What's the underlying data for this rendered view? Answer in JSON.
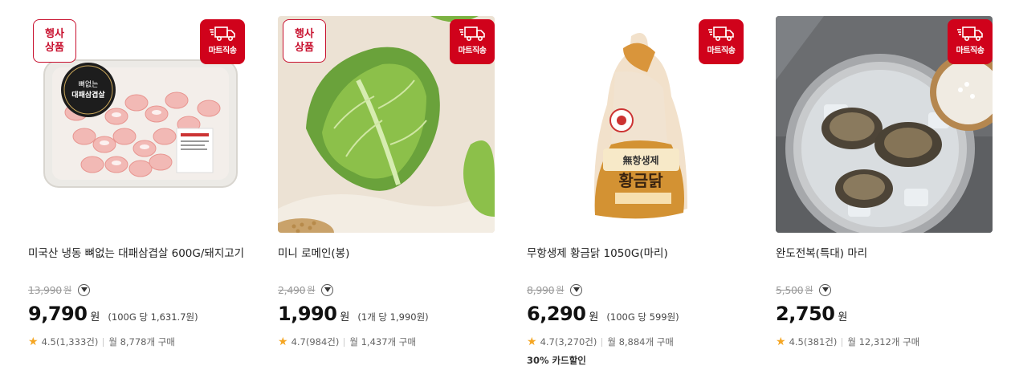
{
  "products": [
    {
      "name": "미국산 냉동 뼈없는 대패삼겹살 600G/돼지고기",
      "original_price": "13,990",
      "original_unit": "원",
      "price": "9,790",
      "price_unit": "원",
      "unit_price": "(100G 당 1,631.7원)",
      "rating": "4.5(1,333건)",
      "monthly": "월 8,778개 구매",
      "event_badge": [
        "행사",
        "상품"
      ],
      "ship_badge": "마트직송",
      "package_label": [
        "뼈없는",
        "대패삼겹살"
      ]
    },
    {
      "name": "미니 로메인(봉)",
      "original_price": "2,490",
      "original_unit": "원",
      "price": "1,990",
      "price_unit": "원",
      "unit_price": "(1개 당 1,990원)",
      "rating": "4.7(984건)",
      "monthly": "월 1,437개 구매",
      "event_badge": [
        "행사",
        "상품"
      ],
      "ship_badge": "마트직송"
    },
    {
      "name": "무항생제 황금닭 1050G(마리)",
      "original_price": "8,990",
      "original_unit": "원",
      "price": "6,290",
      "price_unit": "원",
      "unit_price": "(100G 당 599원)",
      "rating": "4.7(3,270건)",
      "monthly": "월 8,884개 구매",
      "card_discount": "30% 카드할인",
      "ship_badge": "마트직송",
      "package_label": [
        "無항생제",
        "황금닭"
      ]
    },
    {
      "name": "완도전복(특대) 마리",
      "original_price": "5,500",
      "original_unit": "원",
      "price": "2,750",
      "price_unit": "원",
      "unit_price": "",
      "rating": "4.5(381건)",
      "monthly": "월 12,312개 구매",
      "ship_badge": "마트직송"
    }
  ],
  "icons": {
    "truck": "delivery-truck-icon",
    "chevron": "chevron-down-icon",
    "star": "star-icon"
  },
  "colors": {
    "brand_red": "#d0021b",
    "event_red": "#c8102e",
    "star": "#f5a623"
  }
}
